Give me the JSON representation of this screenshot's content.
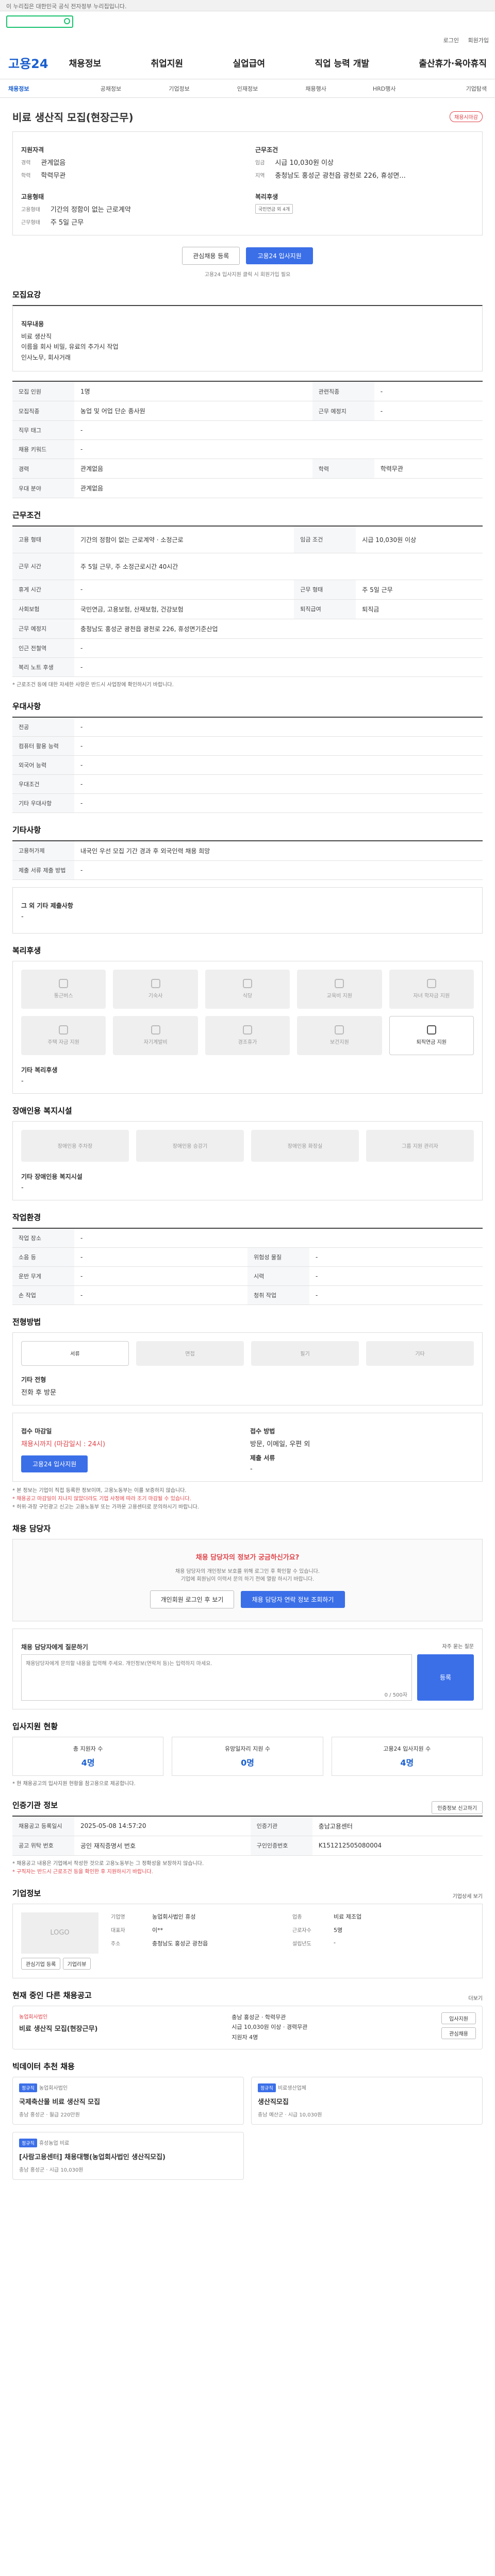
{
  "topbar": {
    "notice": "이 누리집은 대한민국 공식 전자정부 누리집입니다."
  },
  "util": {
    "links": [
      "로그인",
      "회원가입"
    ]
  },
  "gnb": {
    "logo": "고용24",
    "menu": [
      "채용정보",
      "취업지원",
      "실업급여",
      "직업 능력 개발",
      "출산휴가·육아휴직"
    ]
  },
  "subnav": [
    "채용정보",
    "공채정보",
    "기업정보",
    "인재정보",
    "채용행사",
    "HRD행사",
    "기업탐색"
  ],
  "job": {
    "company": "비료 생산직 모집(현장근무)",
    "badge": "채용시마감",
    "cond_head_left": "지원자격",
    "cond_head_right": "근무조건",
    "rows_left": [
      [
        "경력",
        "관계없음"
      ],
      [
        "학력",
        "학력무관"
      ]
    ],
    "rows_right": [
      [
        "임금",
        "시급 10,030원 이상"
      ],
      [
        "지역",
        "충청남도 홍성군 광천읍 광천로 226, 휴성면..."
      ]
    ],
    "pref_left": "고용형태",
    "pref_right": "복리후생",
    "employ_rows": [
      [
        "고용형태",
        "기간의 정함이 없는 근로계약"
      ],
      [
        "근무형태",
        "주 5일 근무"
      ]
    ],
    "welfare": "국민연금 외 4개",
    "btn_interest": "관심채용 등록",
    "btn_apply": "고용24 입사지원",
    "apply_note": "고용24 입사지원 클릭 시 회원가입 필요"
  },
  "duty": {
    "title": "모집요강",
    "desc_label": "직무내용",
    "desc": "비료 생산직\n이름을 회사 비밀, 유료의 추가시 작업\n인사노무, 회사거래",
    "rows": [
      [
        "모집직종",
        "농업 및 어업 단순 종사원",
        "관련직종",
        "-"
      ],
      [
        "직무 태그",
        "-",
        "근무 예정지",
        "-"
      ],
      [
        "채용 키워드",
        "-",
        "",
        ""
      ],
      [
        "경력",
        "관계없음",
        "학력",
        "학력무관"
      ],
      [
        "우대 분야",
        "관계없음",
        "",
        ""
      ]
    ],
    "rows2": [
      [
        "모집 인원",
        "1명"
      ]
    ]
  },
  "work": {
    "title": "근무조건",
    "rows": [
      [
        "고용 형태",
        "기간의 정함이 없는 근로계약 · 소정근로",
        "임금 조건",
        "시급 10,030원 이상"
      ],
      [
        "근무 시간",
        "주 5일 근무, 주 소정근로시간 40시간",
        "",
        ""
      ],
      [
        "휴게 시간",
        "-",
        "근무 형태",
        "주 5일 근무"
      ],
      [
        "사회보험",
        "국민연금, 고용보험, 산재보험, 건강보험",
        "퇴직급여",
        "퇴직금"
      ],
      [
        "근무 예정지",
        "충청남도 홍성군 광천읍 광천로 226, 휴성면기준산업",
        "",
        ""
      ],
      [
        "인근 전철역",
        "-",
        "",
        ""
      ],
      [
        "복리 노트 후생",
        "-",
        "",
        ""
      ]
    ],
    "note": "* 근로조건 등에 대한 자세한 사항은 반드시 사업장에 확인하시기 바랍니다."
  },
  "pref": {
    "title": "우대사항",
    "rows": [
      [
        "전공",
        "-"
      ],
      [
        "컴퓨터 활용 능력",
        "-"
      ],
      [
        "외국어 능력",
        "-"
      ],
      [
        "우대조건",
        "-"
      ],
      [
        "기타 우대사항",
        "-"
      ]
    ]
  },
  "misc": {
    "title": "기타사항",
    "rows": [
      [
        "고용허가제",
        "내국인 우선 모집 기간 경과 후 외국인력 채용 희망"
      ],
      [
        "제출 서류 제출 방법",
        "-"
      ]
    ],
    "etc_label": "그 외 기타 제출사항",
    "etc": "-"
  },
  "facility": {
    "title": "복리후생",
    "tiles": [
      "통근버스",
      "기숙사",
      "식당",
      "교육비 지원",
      "자녀 학자금 지원",
      "주택 자금 지원",
      "자기계발비",
      "경조휴가",
      "보건지원",
      "퇴직연금 지원"
    ],
    "on_index": 9,
    "other_label": "기타 복리후생",
    "other": "-"
  },
  "disabled": {
    "title": "장애인용 복지시설",
    "tiles": [
      "장애인용 주차장",
      "장애인용 승강기",
      "장애인용 화장실",
      "그룹 지원 관리자"
    ],
    "other_label": "기타 장애인용 복지시설",
    "other": "-"
  },
  "workplace": {
    "title": "작업환경",
    "rows": [
      [
        "작업 장소",
        "-",
        "",
        ""
      ],
      [
        "소음 등",
        "-",
        "위험성 물질",
        "-"
      ],
      [
        "운반 무게",
        "-",
        "시력",
        "-"
      ],
      [
        "손 작업",
        "-",
        "청취 작업",
        "-"
      ]
    ]
  },
  "process": {
    "title": "전형방법",
    "steps": [
      "서류",
      "면접",
      "필기",
      "기타"
    ],
    "type_label": "기타 전형",
    "type": "전화 후 방문",
    "deadline_label": "접수 마감일",
    "deadline": "채용시까지 (마감일시 : 24시)",
    "method_label": "접수 방법",
    "method": "방문, 이메일, 우편 외",
    "doc_label": "제출 서류",
    "doc": "-",
    "btn": "고용24 입사지원",
    "notes": [
      "* 본 정보는 기업이 직접 등록한 정보이며, 고용노동부는 이를 보증하지 않습니다.",
      "* 채용공고 마감일이 지나지 않았더라도 기업 사정에 따라 조기 마감될 수 있습니다.",
      "* 허위·과장 구인광고 신고는 고용노동부 또는 가까운 고용센터로 문의하시기 바랍니다."
    ]
  },
  "manager": {
    "title": "채용 담당자",
    "alert": "채용 담당자의 정보가 궁금하신가요?",
    "desc": "채용 담당자의 개인정보 보호를 위해 로그인 후 확인할 수 있습니다.",
    "desc2": "기업에 회원님이 이력서 문의 하기 전에 열람 하시기 바랍니다.",
    "btn_login": "개인회원 로그인 후 보기",
    "btn_inquire": "채용 담당자 연락 정보 조회하기"
  },
  "inquiry": {
    "label": "채용 담당자에게 질문하기",
    "placeholder": "채용담당자에게 문의할 내용을 입력해 주세요. 개인정보(연락처 등)는 입력하지 마세요.",
    "count": "0 / 500자",
    "btn": "등록",
    "links": "자주 묻는 질문"
  },
  "status": {
    "title": "입사지원 현황",
    "cards": [
      [
        "총 지원자 수",
        "4명"
      ],
      [
        "유망일자리 지원 수",
        "0명"
      ],
      [
        "고용24 입사지원 수",
        "4명"
      ]
    ],
    "note": "* 현 채용공고의 입사지원 현황을 참고용으로 제공합니다."
  },
  "cert": {
    "title": "인증기관 정보",
    "btn": "인증정보 신고하기",
    "rows": [
      [
        "채용공고 등록일시",
        "2025-05-08 14:57:20",
        "인증기관",
        "충남고용센터"
      ],
      [
        "공고 위탁 번호",
        "공인 재직증명서 번호",
        "구인인증번호",
        "K151212505080004"
      ]
    ],
    "notes": [
      "* 채용공고 내용은 기업에서 작성한 것으로 고용노동부는 그 정확성을 보장하지 않습니다.",
      "* 구직자는 반드시 근로조건 등을 확인한 후 지원하시기 바랍니다."
    ]
  },
  "company": {
    "title": "기업정보",
    "more": "기업상세 보기",
    "logo_label": "LOGO",
    "rows": [
      [
        "기업명",
        "농업회사법인 휴성",
        "업종",
        "비료 제조업"
      ],
      [
        "대표자",
        "이**",
        "근로자수",
        "5명"
      ],
      [
        "주소",
        "충청남도 홍성군 광천읍",
        "설립년도",
        "-"
      ]
    ],
    "btns": [
      "관심기업 등록",
      "기업리뷰"
    ]
  },
  "similar": {
    "title": "현재 중인 다른 채용공고",
    "more": "더보기",
    "company": "농업회사법인",
    "job": "비료 생산직 모집(현장근무)",
    "loc": "충남 홍성군",
    "wage": "시급 10,030원 이상",
    "edu": "학력무관",
    "exp": "경력무관",
    "apply_count": "지원자 4명",
    "btns": [
      "입사지원",
      "관심채용"
    ]
  },
  "recommend": {
    "title": "빅데이터 추천 채용",
    "items": [
      {
        "tag": "정규직",
        "company": "농업회사법인",
        "job": "국제축산물 비료 생산직 모집",
        "loc": "충남 홍성군",
        "wage": "월급 220만원"
      },
      {
        "tag": "정규직",
        "company": "비료생산업체",
        "job": "생산직모집",
        "loc": "충남 예산군",
        "wage": "시급 10,030원"
      },
      {
        "tag": "정규직",
        "company": "휴성농업 비료",
        "job": "[사람고용센터] 채용대행(농업회사법인 생산직모집)",
        "loc": "충남 홍성군",
        "wage": "시급 10,030원"
      }
    ]
  }
}
